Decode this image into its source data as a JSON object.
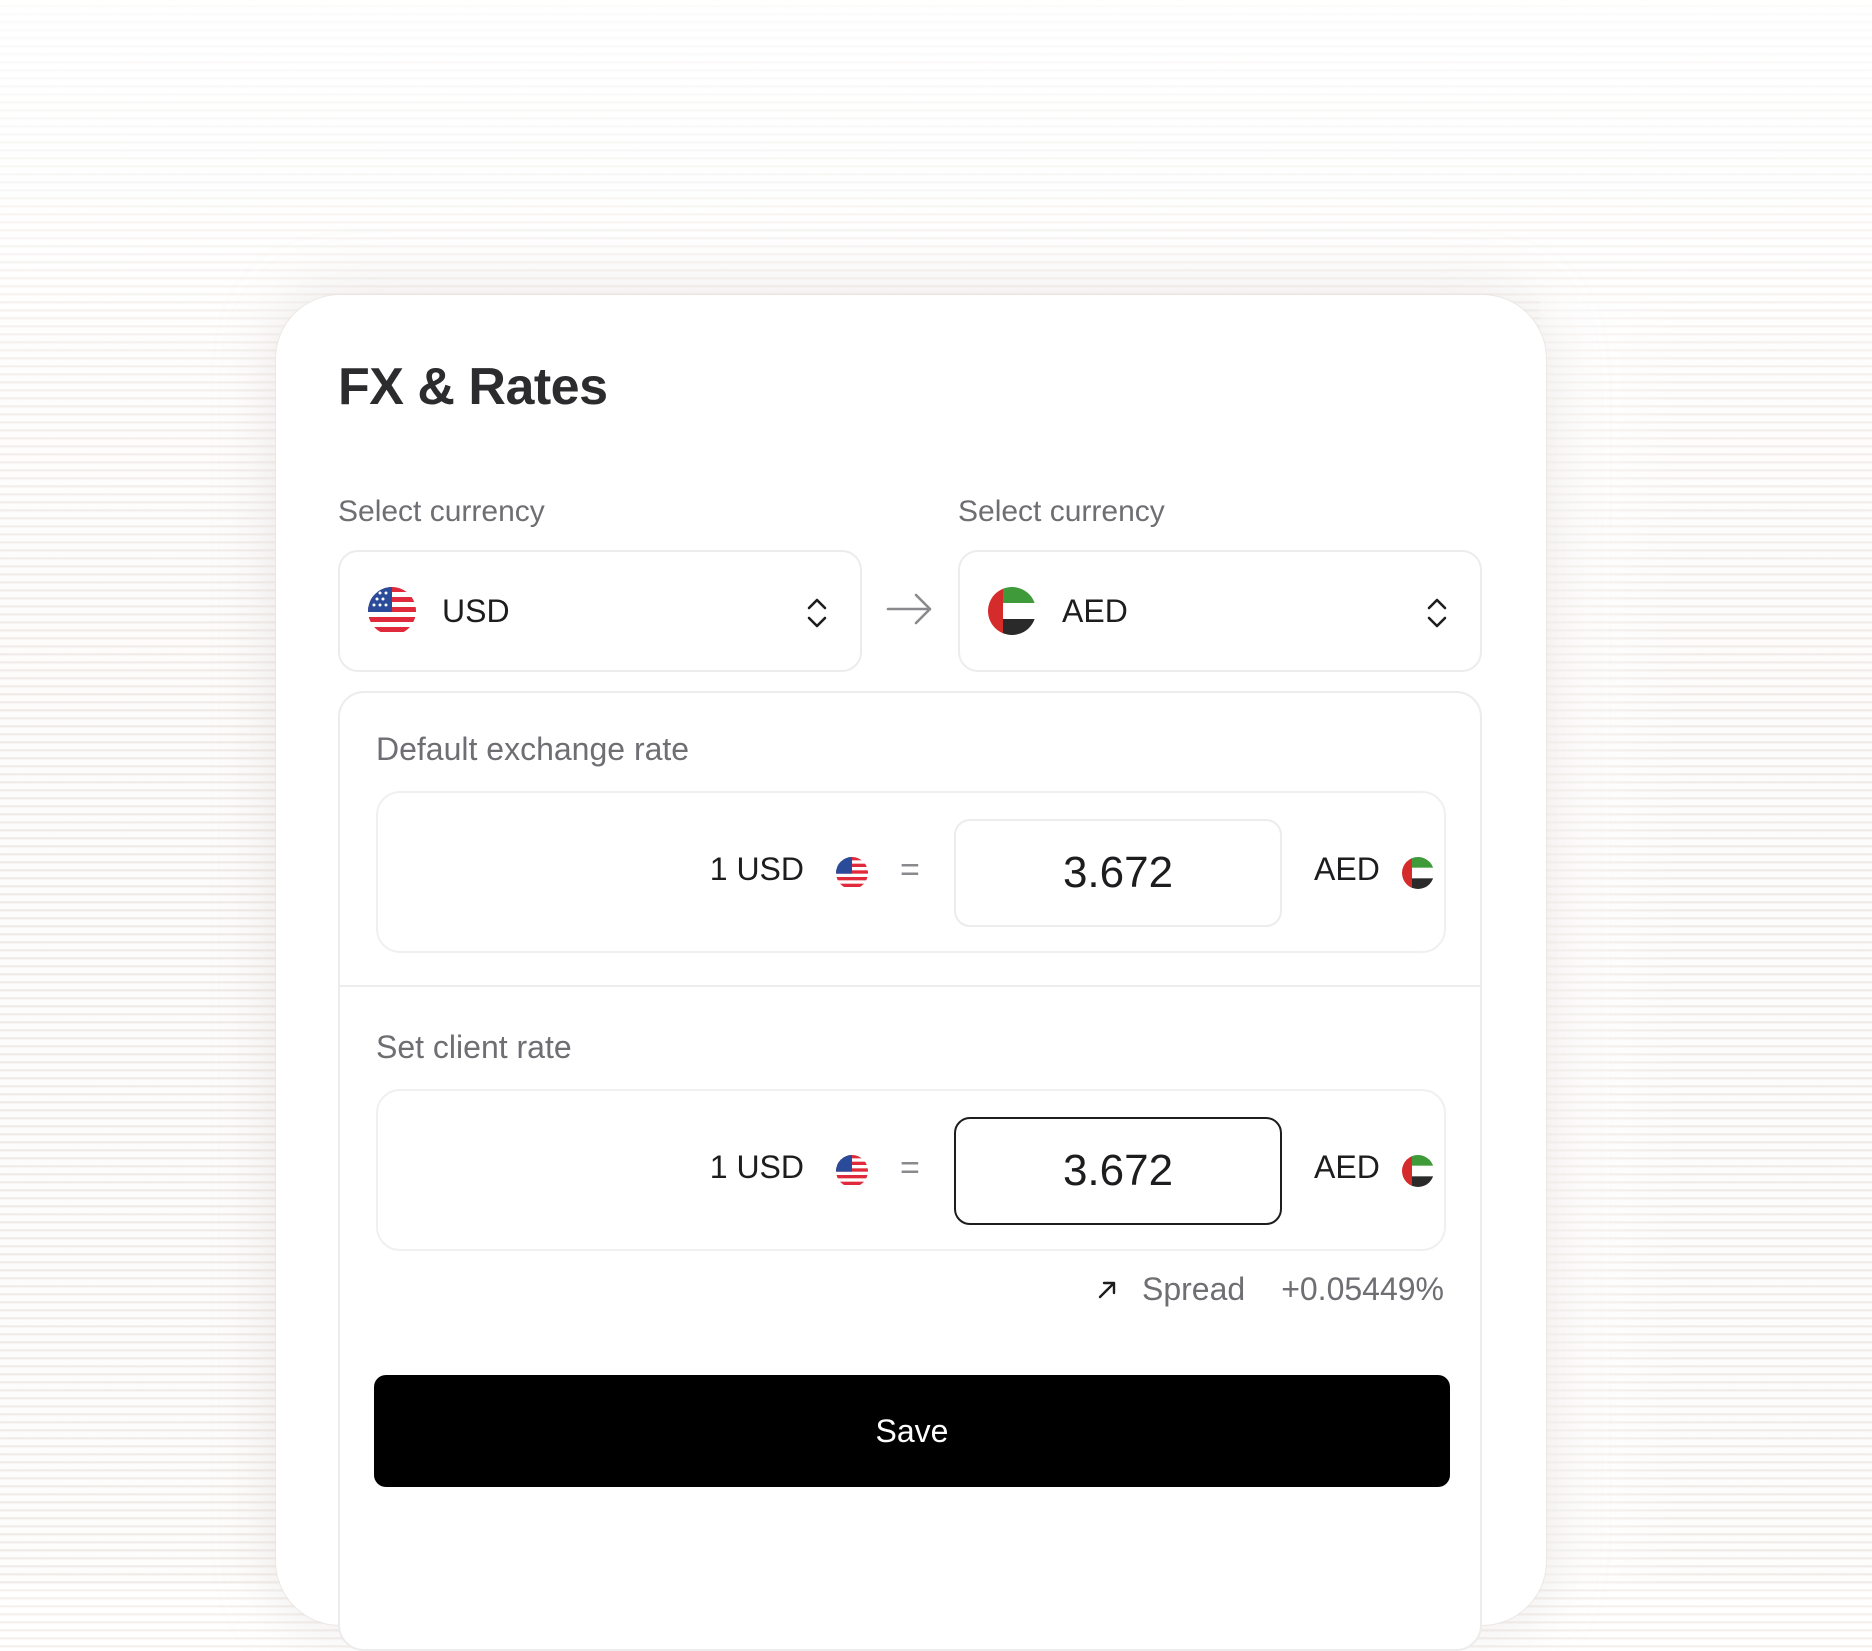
{
  "title": "FX & Rates",
  "from": {
    "label": "Select currency",
    "code": "USD",
    "flag": "us-flag-icon"
  },
  "to": {
    "label": "Select currency",
    "code": "AED",
    "flag": "uae-flag-icon"
  },
  "default_rate": {
    "label": "Default exchange rate",
    "base": "1 USD",
    "equals": "=",
    "value": "3.672",
    "quote": "AED"
  },
  "client_rate": {
    "label": "Set client rate",
    "base": "1 USD",
    "equals": "=",
    "value": "3.672",
    "quote": "AED"
  },
  "spread": {
    "label": "Spread",
    "value": "+0.05449%",
    "icon": "arrow-up-right-icon"
  },
  "save_label": "Save",
  "colors": {
    "primary_button": "#000000",
    "text": "#1d1d1f",
    "muted": "#6e6e73",
    "border": "#ececec"
  }
}
